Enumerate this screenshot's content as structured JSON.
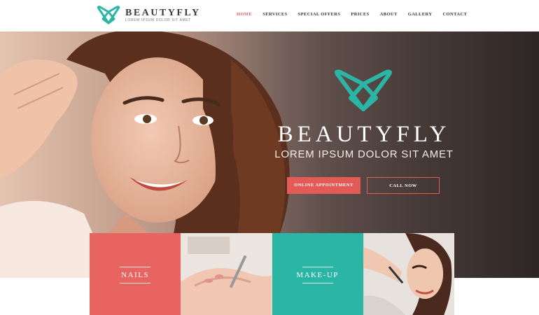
{
  "brand": {
    "name": "BEAUTYFLY",
    "tagline": "LOREM IPSUM DOLOR SIT AMET",
    "accent_color": "#e25b57",
    "teal_color": "#2ab5a5"
  },
  "nav": {
    "items": [
      {
        "label": "HOME",
        "active": true
      },
      {
        "label": "SERVICES",
        "active": false
      },
      {
        "label": "SPECIAL OFFERS",
        "active": false
      },
      {
        "label": "PRICES",
        "active": false
      },
      {
        "label": "ABOUT",
        "active": false
      },
      {
        "label": "GALLERY",
        "active": false
      },
      {
        "label": "CONTACT",
        "active": false
      }
    ]
  },
  "hero": {
    "title": "BEAUTYFLY",
    "subtitle": "LOREM IPSUM DOLOR SIT AMET",
    "primary_button": "ONLINE APPOINTMENT",
    "secondary_button": "CALL NOW",
    "image": "woman-portrait-photo"
  },
  "tiles": [
    {
      "type": "label",
      "label": "NAILS",
      "color": "#e76460"
    },
    {
      "type": "photo",
      "image": "manicure-photo"
    },
    {
      "type": "label",
      "label": "MAKE-UP",
      "color": "#2ab5a5"
    },
    {
      "type": "photo",
      "image": "makeup-application-photo"
    }
  ]
}
